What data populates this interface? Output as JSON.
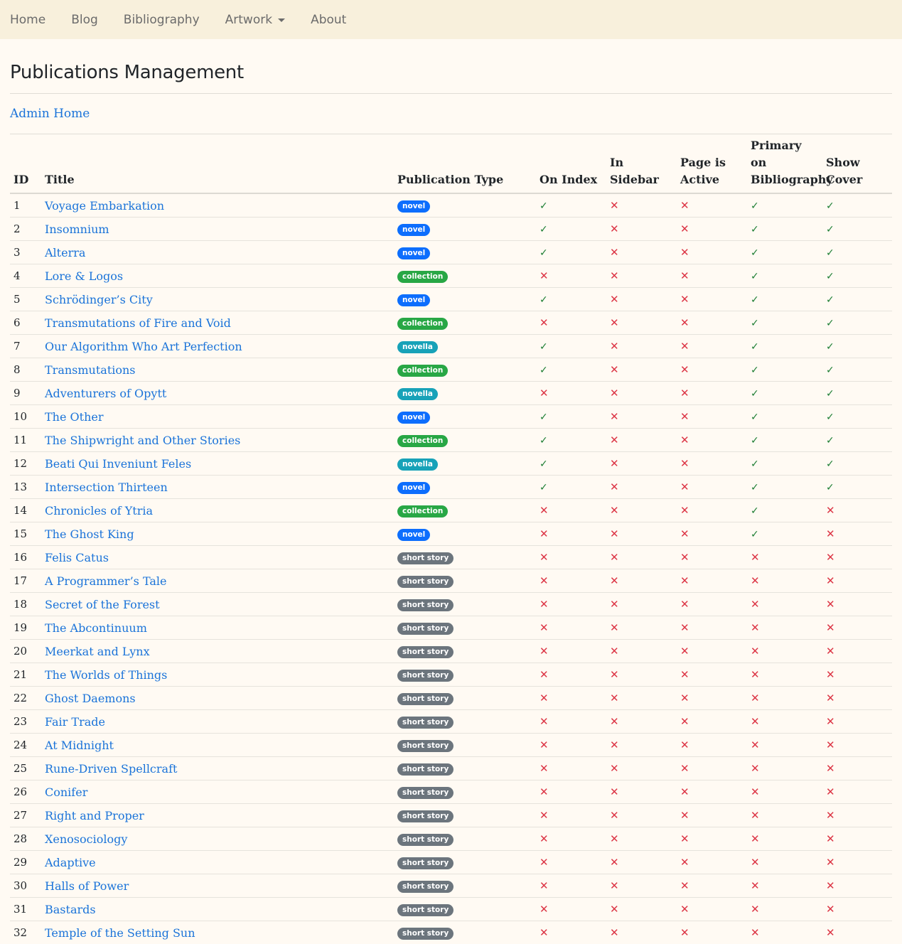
{
  "nav": {
    "items": [
      "Home",
      "Blog",
      "Bibliography",
      "Artwork",
      "About"
    ]
  },
  "page_title": "Publications Management",
  "admin_home": "Admin Home",
  "table": {
    "headers": [
      "ID",
      "Title",
      "Publication Type",
      "On Index",
      "In Sidebar",
      "Page is Active",
      "Primary on Bibliography",
      "Show Cover"
    ],
    "rows": [
      {
        "id": "1",
        "title": "Voyage Embarkation",
        "type": "novel",
        "flags": [
          true,
          false,
          false,
          true,
          true
        ]
      },
      {
        "id": "2",
        "title": "Insomnium",
        "type": "novel",
        "flags": [
          true,
          false,
          false,
          true,
          true
        ]
      },
      {
        "id": "3",
        "title": "Alterra",
        "type": "novel",
        "flags": [
          true,
          false,
          false,
          true,
          true
        ]
      },
      {
        "id": "4",
        "title": "Lore & Logos",
        "type": "collection",
        "flags": [
          false,
          false,
          false,
          true,
          true
        ]
      },
      {
        "id": "5",
        "title": "Schrödinger’s City",
        "type": "novel",
        "flags": [
          true,
          false,
          false,
          true,
          true
        ]
      },
      {
        "id": "6",
        "title": "Transmutations of Fire and Void",
        "type": "collection",
        "flags": [
          false,
          false,
          false,
          true,
          true
        ]
      },
      {
        "id": "7",
        "title": "Our Algorithm Who Art Perfection",
        "type": "novella",
        "flags": [
          true,
          false,
          false,
          true,
          true
        ]
      },
      {
        "id": "8",
        "title": "Transmutations",
        "type": "collection",
        "flags": [
          true,
          false,
          false,
          true,
          true
        ]
      },
      {
        "id": "9",
        "title": "Adventurers of Opytt",
        "type": "novella",
        "flags": [
          false,
          false,
          false,
          true,
          true
        ]
      },
      {
        "id": "10",
        "title": "The Other",
        "type": "novel",
        "flags": [
          true,
          false,
          false,
          true,
          true
        ]
      },
      {
        "id": "11",
        "title": "The Shipwright and Other Stories",
        "type": "collection",
        "flags": [
          true,
          false,
          false,
          true,
          true
        ]
      },
      {
        "id": "12",
        "title": "Beati Qui Inveniunt Feles",
        "type": "novella",
        "flags": [
          true,
          false,
          false,
          true,
          true
        ]
      },
      {
        "id": "13",
        "title": "Intersection Thirteen",
        "type": "novel",
        "flags": [
          true,
          false,
          false,
          true,
          true
        ]
      },
      {
        "id": "14",
        "title": "Chronicles of Ytria",
        "type": "collection",
        "flags": [
          false,
          false,
          false,
          true,
          false
        ]
      },
      {
        "id": "15",
        "title": "The Ghost King",
        "type": "novel",
        "flags": [
          false,
          false,
          false,
          true,
          false
        ]
      },
      {
        "id": "16",
        "title": "Felis Catus",
        "type": "short story",
        "flags": [
          false,
          false,
          false,
          false,
          false
        ]
      },
      {
        "id": "17",
        "title": "A Programmer’s Tale",
        "type": "short story",
        "flags": [
          false,
          false,
          false,
          false,
          false
        ]
      },
      {
        "id": "18",
        "title": "Secret of the Forest",
        "type": "short story",
        "flags": [
          false,
          false,
          false,
          false,
          false
        ]
      },
      {
        "id": "19",
        "title": "The Abcontinuum",
        "type": "short story",
        "flags": [
          false,
          false,
          false,
          false,
          false
        ]
      },
      {
        "id": "20",
        "title": "Meerkat and Lynx",
        "type": "short story",
        "flags": [
          false,
          false,
          false,
          false,
          false
        ]
      },
      {
        "id": "21",
        "title": "The Worlds of Things",
        "type": "short story",
        "flags": [
          false,
          false,
          false,
          false,
          false
        ]
      },
      {
        "id": "22",
        "title": "Ghost Daemons",
        "type": "short story",
        "flags": [
          false,
          false,
          false,
          false,
          false
        ]
      },
      {
        "id": "23",
        "title": "Fair Trade",
        "type": "short story",
        "flags": [
          false,
          false,
          false,
          false,
          false
        ]
      },
      {
        "id": "24",
        "title": "At Midnight",
        "type": "short story",
        "flags": [
          false,
          false,
          false,
          false,
          false
        ]
      },
      {
        "id": "25",
        "title": "Rune-Driven Spellcraft",
        "type": "short story",
        "flags": [
          false,
          false,
          false,
          false,
          false
        ]
      },
      {
        "id": "26",
        "title": "Conifer",
        "type": "short story",
        "flags": [
          false,
          false,
          false,
          false,
          false
        ]
      },
      {
        "id": "27",
        "title": "Right and Proper",
        "type": "short story",
        "flags": [
          false,
          false,
          false,
          false,
          false
        ]
      },
      {
        "id": "28",
        "title": "Xenosociology",
        "type": "short story",
        "flags": [
          false,
          false,
          false,
          false,
          false
        ]
      },
      {
        "id": "29",
        "title": "Adaptive",
        "type": "short story",
        "flags": [
          false,
          false,
          false,
          false,
          false
        ]
      },
      {
        "id": "30",
        "title": "Halls of Power",
        "type": "short story",
        "flags": [
          false,
          false,
          false,
          false,
          false
        ]
      },
      {
        "id": "31",
        "title": "Bastards",
        "type": "short story",
        "flags": [
          false,
          false,
          false,
          false,
          false
        ]
      },
      {
        "id": "32",
        "title": "Temple of the Setting Sun",
        "type": "short story",
        "flags": [
          false,
          false,
          false,
          false,
          false
        ]
      }
    ]
  },
  "symbols": {
    "yes": "✓",
    "no": "✕"
  },
  "colors": {
    "novel": "#0d6efd",
    "collection": "#28a745",
    "novella": "#17a2b8",
    "short story": "#6c757d",
    "yes": "#1e7e34",
    "no": "#dc3545",
    "link": "#1a73d9",
    "navbar_bg": "#f8f0dc",
    "page_bg": "#fffaf3"
  }
}
